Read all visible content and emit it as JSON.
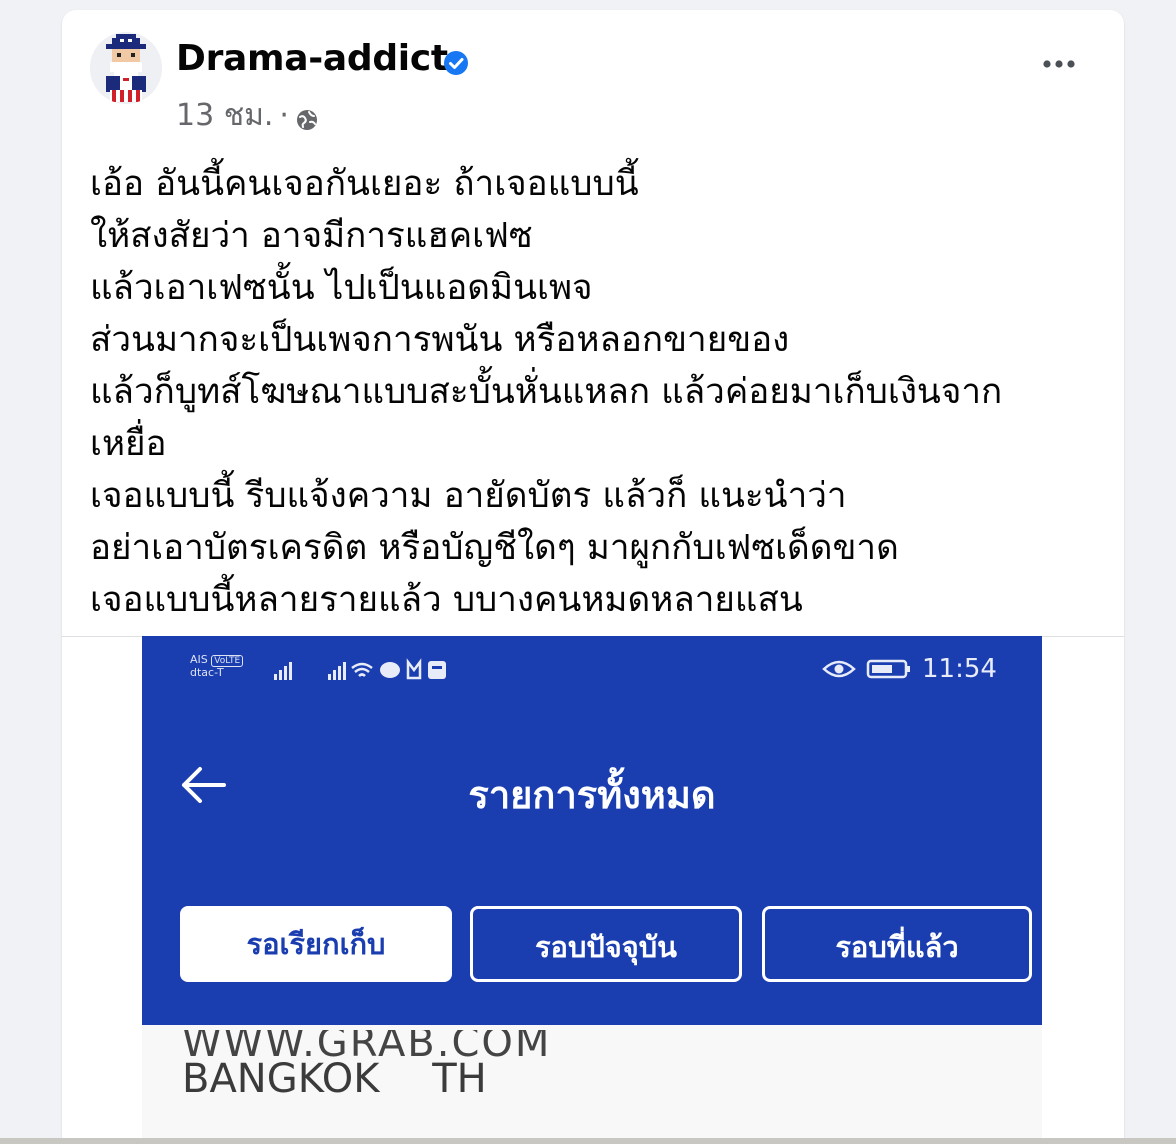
{
  "post": {
    "author": "Drama-addict",
    "time": "13 ชม.",
    "separator": "·",
    "lines": [
      "เอ้อ อันนี้คนเจอกันเยอะ ถ้าเจอแบบนี้",
      " ให้สงสัยว่า อาจมีการแฮคเฟซ",
      "แล้วเอาเฟซนั้น ไปเป็นแอดมินเพจ",
      "ส่วนมากจะเป็นเพจการพนัน หรือหลอกขายของ",
      "แล้วก็บูทส์โฆษณาแบบสะบั้นหั่นแหลก แล้วค่อยมาเก็บเงินจาก",
      "เหยื่อ",
      "เจอแบบนี้ รีบแจ้งความ อายัดบัตร แล้วก็ แนะนำว่า",
      "อย่าเอาบัตรเครดิต หรือบัญชีใดๆ มาผูกกับเฟซเด็ดขาด",
      "เจอแบบนี้หลายรายแล้ว บบางคนหมดหลายแสน"
    ]
  },
  "screenshot": {
    "status_bar": {
      "carrier_top": "AIS",
      "carrier_badge": "VoLTE",
      "carrier_bottom": "dtac-T",
      "time": "11:54"
    },
    "title": "รายการทั้งหมด",
    "tabs": [
      "รอเรียกเก็บ",
      "รอบปัจจุบัน",
      "รอบที่แล้ว"
    ],
    "partial_url": "WWW.GRAB.COM",
    "location": "BANGKOK TH"
  },
  "icons": {
    "verified": "verified-badge-icon",
    "audience": "globe-icon",
    "more": "more-options-icon",
    "back": "back-arrow-icon"
  },
  "colors": {
    "verified_blue": "#1877f2",
    "app_blue": "#1a3eb0",
    "meta_gray": "#65676b"
  }
}
